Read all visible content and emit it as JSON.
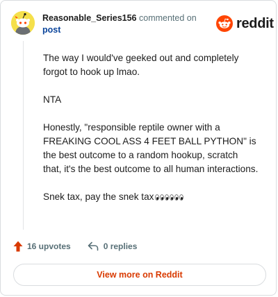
{
  "header": {
    "username": "Reasonable_Series156",
    "commented_text": "commented on",
    "post_link": "post"
  },
  "brand": {
    "wordmark": "reddit",
    "logo_icon": "reddit-snoo-icon",
    "accent_color": "#ff4500"
  },
  "comment": {
    "paragraphs": [
      "The way I would've geeked out and completely forgot to hook up lmao.",
      "NTA",
      "Honestly, \"responsible reptile owner with a FREAKING COOL ASS 4 FEET BALL PYTHON\" is the best outcome to a random hookup, scratch that, it's the best outcome to all human interactions.",
      "Snek tax, pay the snek tax"
    ],
    "emoji": "eyes-emoji-x3"
  },
  "actions": {
    "upvotes": "16 upvotes",
    "replies": "0 replies",
    "upvote_color": "#d93a00"
  },
  "footer": {
    "view_more": "View more on Reddit"
  },
  "colors": {
    "link": "#0a449b",
    "muted": "#576f76",
    "avatar_bg": "#f5e04b"
  }
}
